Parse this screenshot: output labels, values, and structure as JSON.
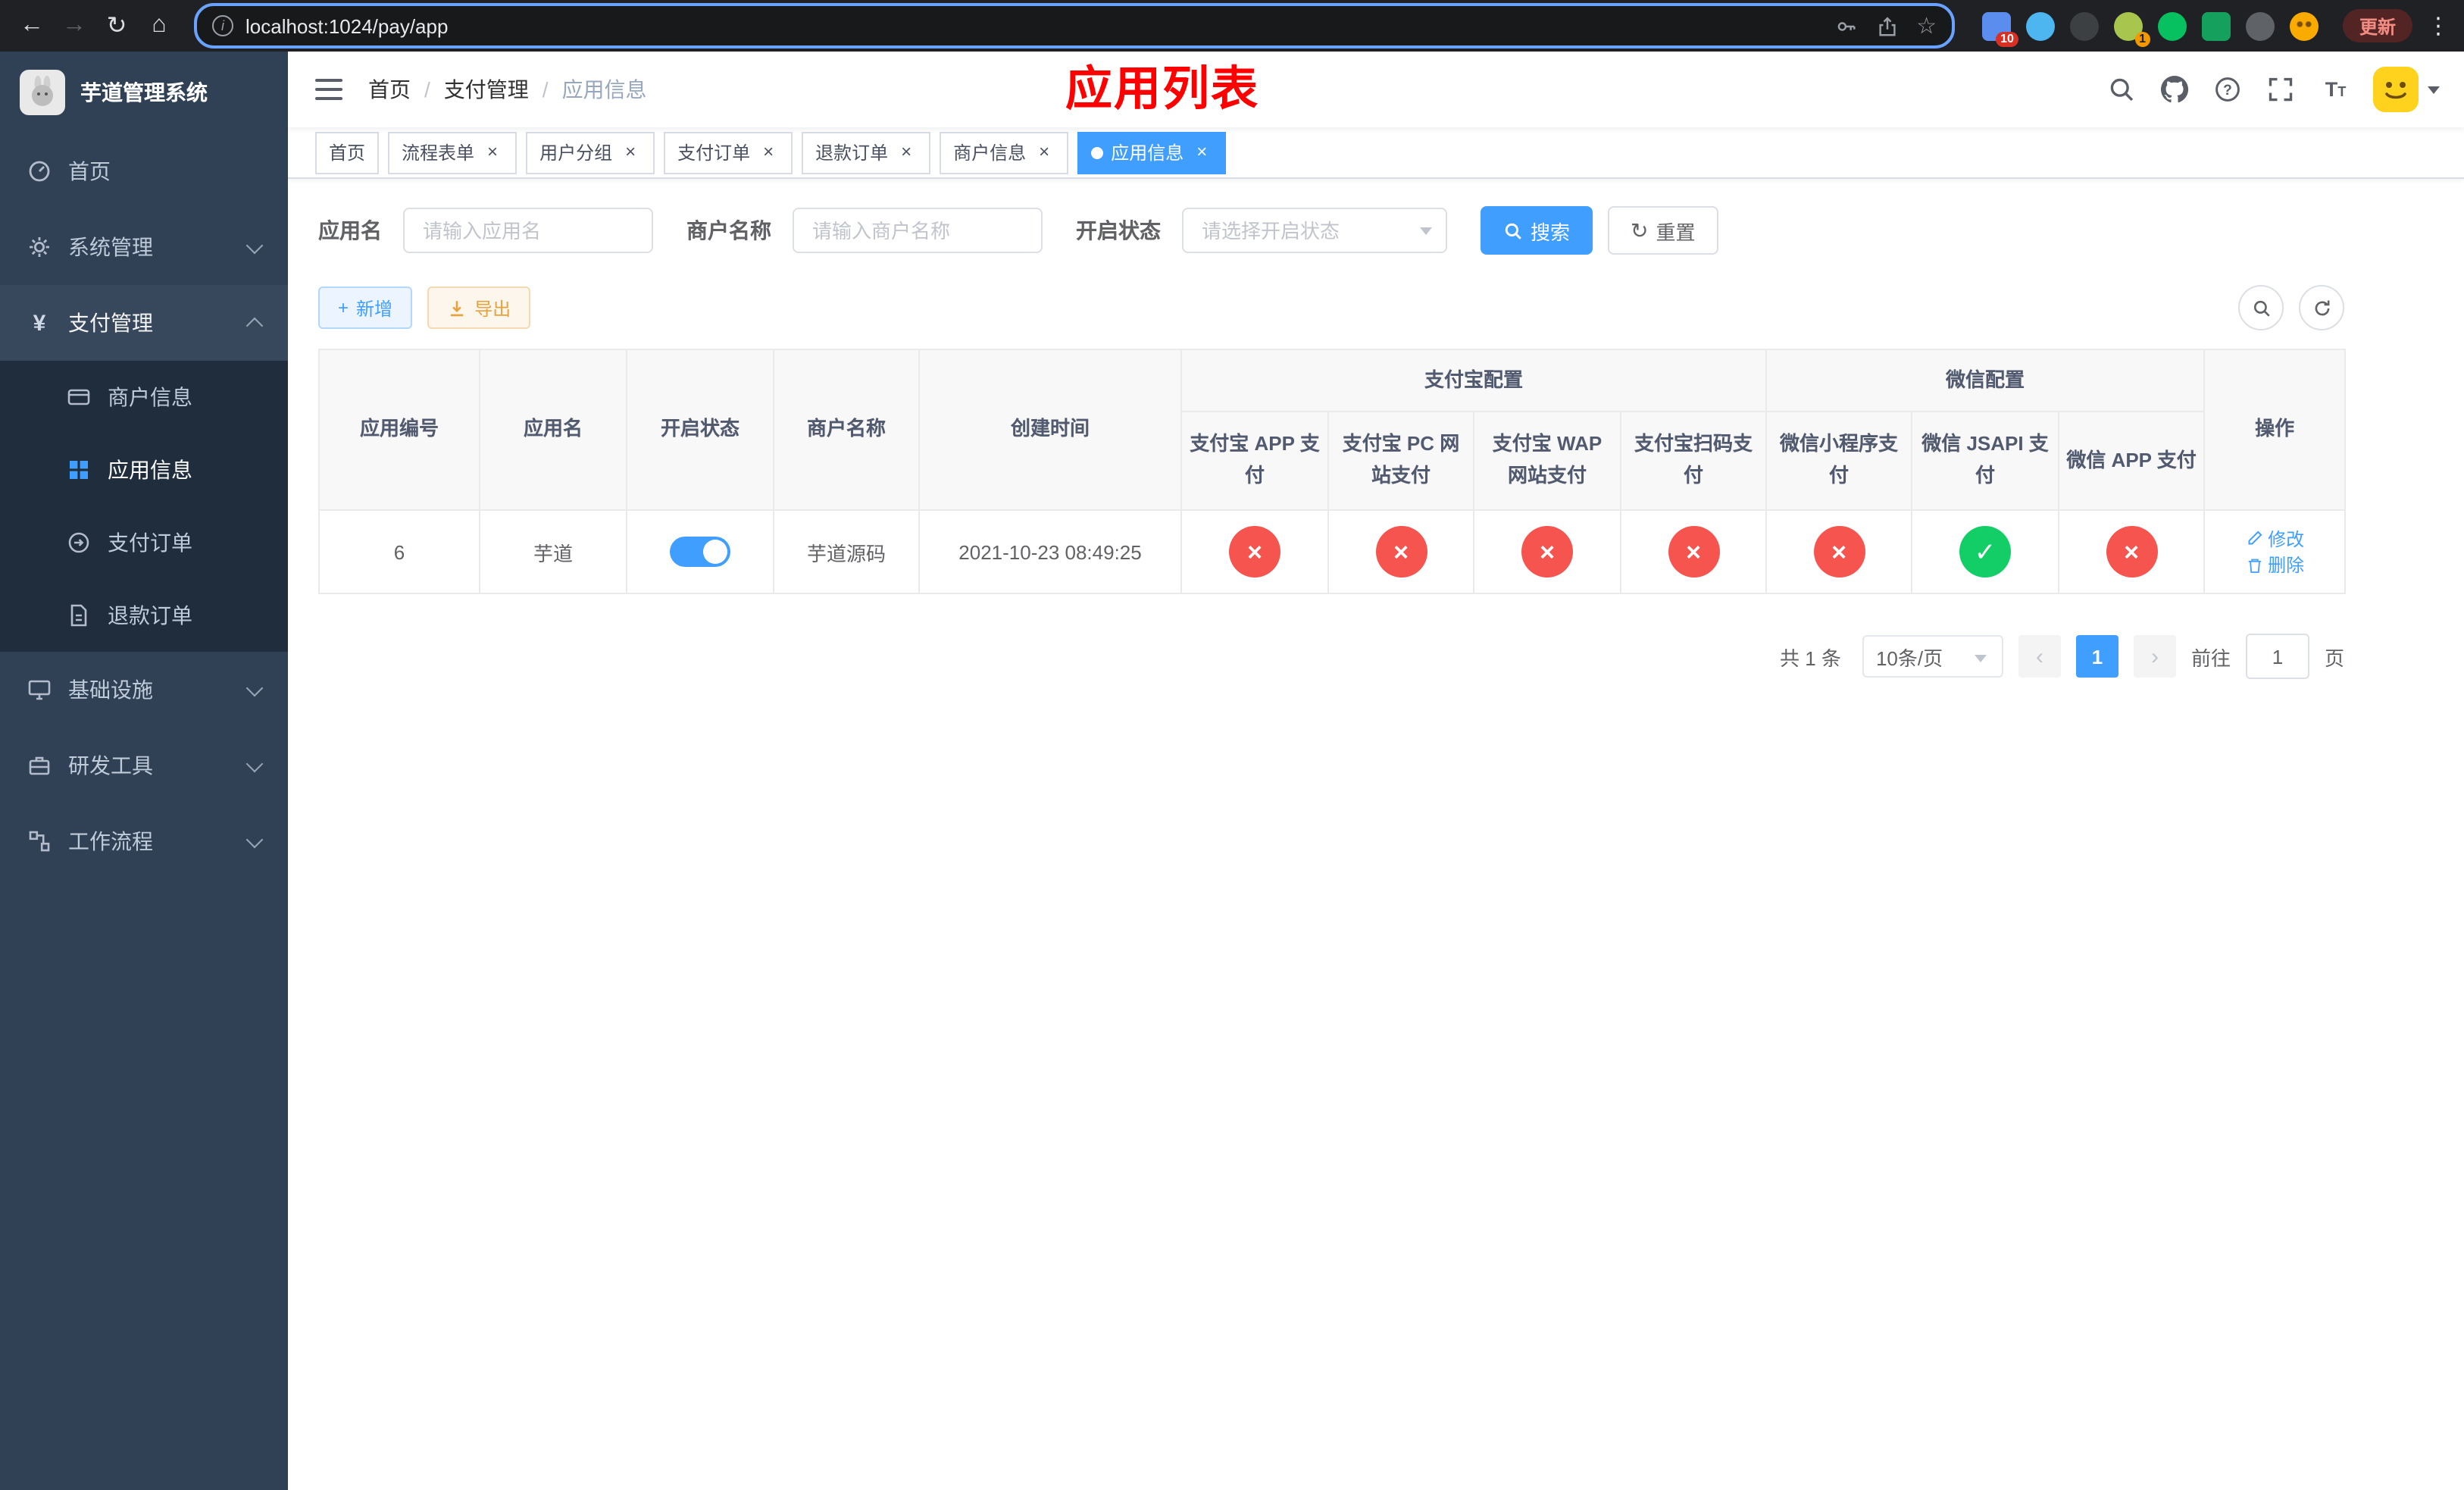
{
  "browser": {
    "url": "localhost:1024/pay/app",
    "update_label": "更新",
    "ext_badge_a": "10",
    "ext_badge_b": "1"
  },
  "sidebar": {
    "title": "芋道管理系统",
    "items": [
      {
        "label": "首页"
      },
      {
        "label": "系统管理"
      },
      {
        "label": "支付管理"
      },
      {
        "label": "基础设施"
      },
      {
        "label": "研发工具"
      },
      {
        "label": "工作流程"
      }
    ],
    "pay_children": [
      {
        "label": "商户信息"
      },
      {
        "label": "应用信息"
      },
      {
        "label": "支付订单"
      },
      {
        "label": "退款订单"
      }
    ]
  },
  "navbar": {
    "breadcrumb": [
      "首页",
      "支付管理",
      "应用信息"
    ],
    "annotation": "应用列表"
  },
  "tabs": [
    {
      "label": "首页"
    },
    {
      "label": "流程表单"
    },
    {
      "label": "用户分组"
    },
    {
      "label": "支付订单"
    },
    {
      "label": "退款订单"
    },
    {
      "label": "商户信息"
    },
    {
      "label": "应用信息"
    }
  ],
  "filter": {
    "app_name_label": "应用名",
    "app_name_placeholder": "请输入应用名",
    "merchant_label": "商户名称",
    "merchant_placeholder": "请输入商户名称",
    "status_label": "开启状态",
    "status_placeholder": "请选择开启状态",
    "search_label": "搜索",
    "reset_label": "重置"
  },
  "toolbar": {
    "add_label": "新增",
    "export_label": "导出"
  },
  "table": {
    "group_headers": {
      "alipay": "支付宝配置",
      "wechat": "微信配置"
    },
    "headers": {
      "app_id": "应用编号",
      "app_name": "应用名",
      "status": "开启状态",
      "merchant": "商户名称",
      "created": "创建时间",
      "alipay_app": "支付宝 APP 支付",
      "alipay_pc": "支付宝 PC 网站支付",
      "alipay_wap": "支付宝 WAP 网站支付",
      "alipay_qr": "支付宝扫码支付",
      "wx_mini": "微信小程序支付",
      "wx_jsapi": "微信 JSAPI 支付",
      "wx_app": "微信 APP 支付",
      "actions": "操作"
    },
    "rows": [
      {
        "app_id": "6",
        "app_name": "芋道",
        "enabled": true,
        "merchant": "芋道源码",
        "created": "2021-10-23 08:49:25",
        "alipay_app": false,
        "alipay_pc": false,
        "alipay_wap": false,
        "alipay_qr": false,
        "wx_mini": false,
        "wx_jsapi": true,
        "wx_app": false,
        "edit_label": "修改",
        "delete_label": "删除"
      }
    ]
  },
  "pagination": {
    "total": "共 1 条",
    "page_size": "10条/页",
    "page": "1",
    "goto_prefix": "前往",
    "goto_value": "1",
    "goto_suffix": "页"
  }
}
